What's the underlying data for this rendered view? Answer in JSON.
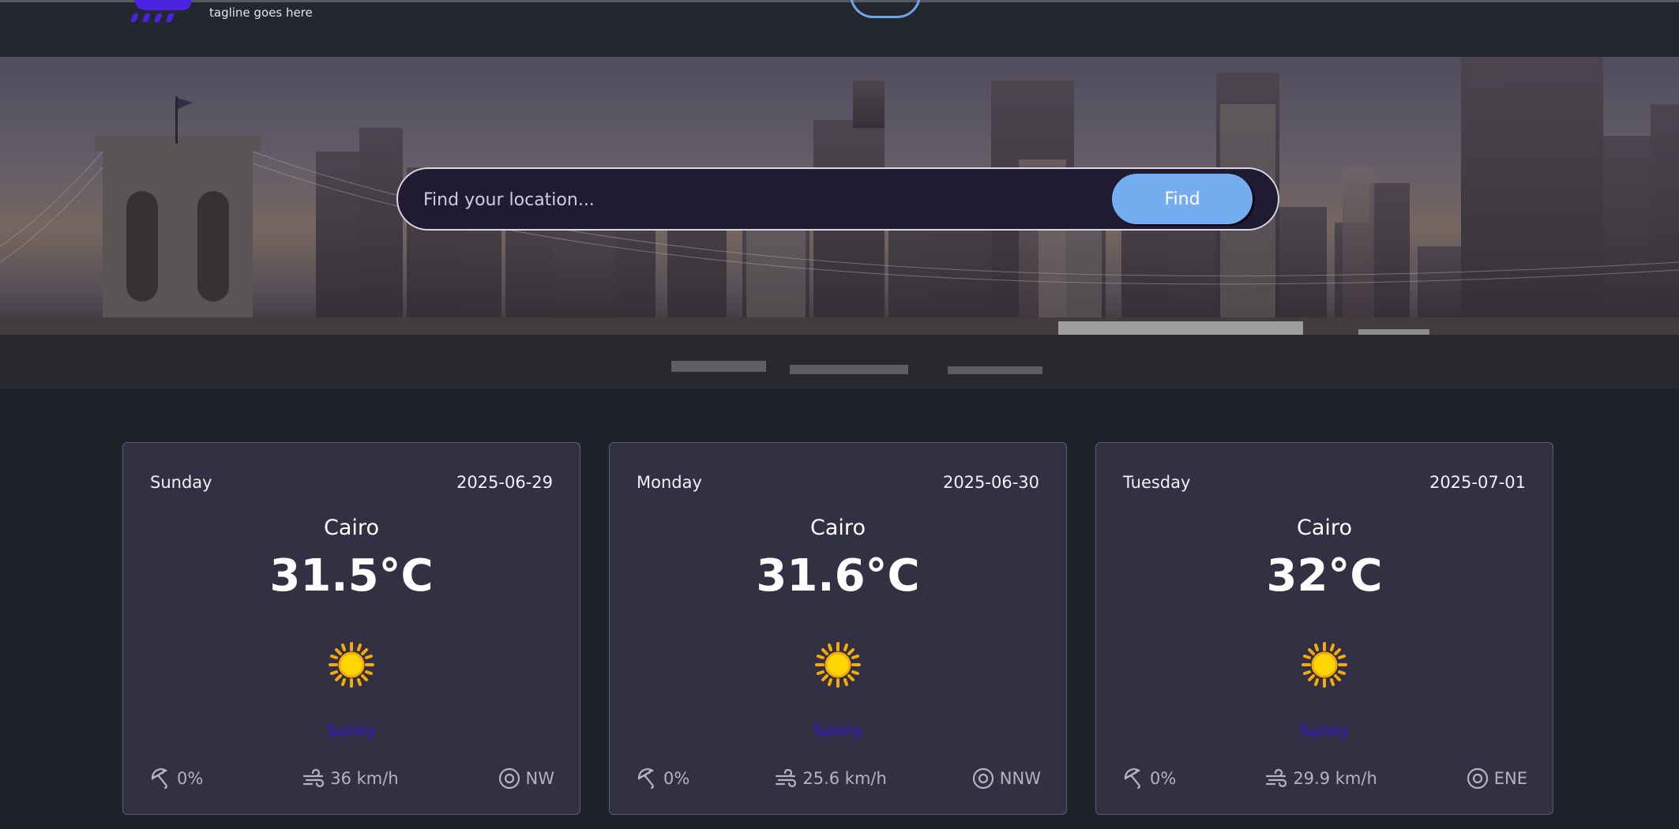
{
  "header": {
    "tagline": "tagline goes here",
    "logo_icon": "cloud-rain-icon",
    "accent_color": "#4a22e0"
  },
  "search": {
    "placeholder": "Find your location...",
    "value": "",
    "button_label": "Find",
    "button_color": "#74aef0"
  },
  "forecast": [
    {
      "day": "Sunday",
      "date": "2025-06-29",
      "city": "Cairo",
      "temp": "31.5°C",
      "icon": "sun-icon",
      "condition": "Sunny",
      "rain": "0%",
      "wind_speed": "36 km/h",
      "wind_dir": "NW"
    },
    {
      "day": "Monday",
      "date": "2025-06-30",
      "city": "Cairo",
      "temp": "31.6°C",
      "icon": "sun-icon",
      "condition": "Sunny",
      "rain": "0%",
      "wind_speed": "25.6 km/h",
      "wind_dir": "NNW"
    },
    {
      "day": "Tuesday",
      "date": "2025-07-01",
      "city": "Cairo",
      "temp": "32°C",
      "icon": "sun-icon",
      "condition": "Sunny",
      "rain": "0%",
      "wind_speed": "29.9 km/h",
      "wind_dir": "ENE"
    }
  ]
}
